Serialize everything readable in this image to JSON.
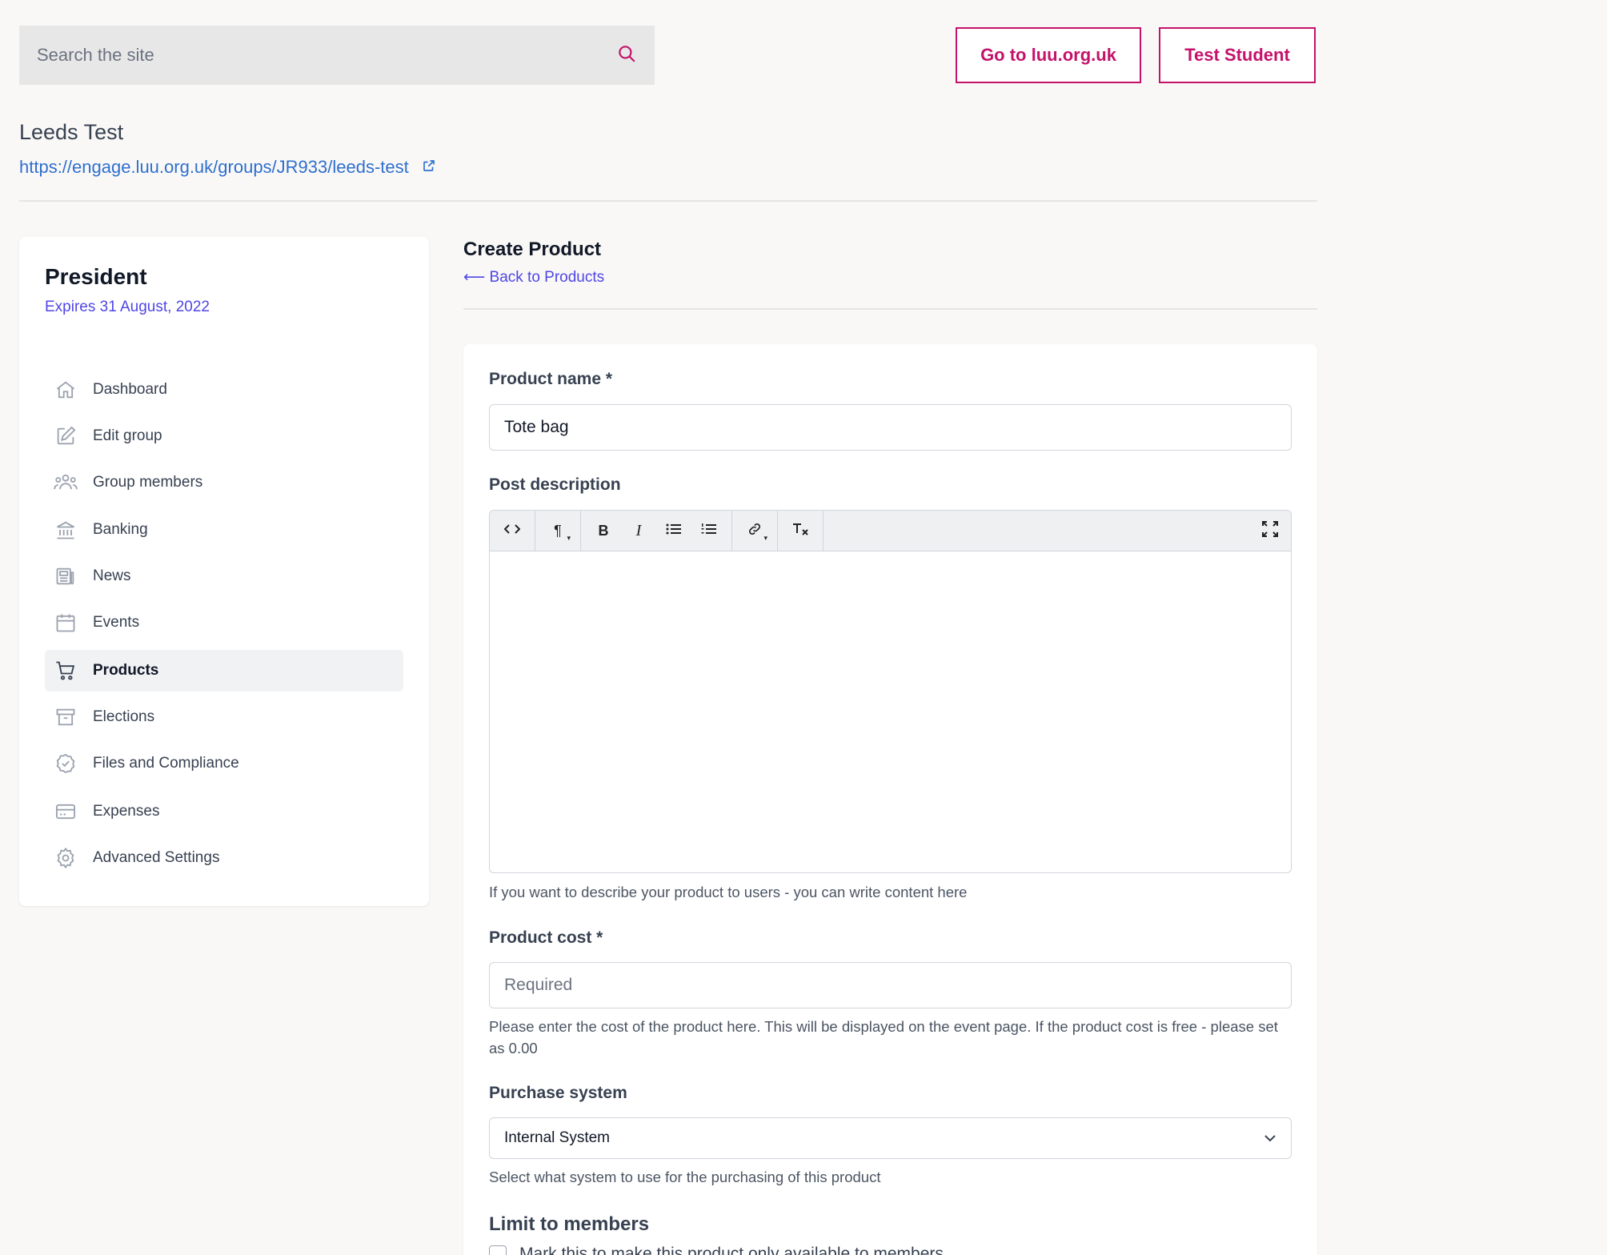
{
  "header": {
    "search_placeholder": "Search the site",
    "go_to_label": "Go to luu.org.uk",
    "user_label": "Test Student"
  },
  "group": {
    "name": "Leeds Test",
    "url": "https://engage.luu.org.uk/groups/JR933/leeds-test"
  },
  "sidebar": {
    "role": "President",
    "expires": "Expires 31 August, 2022",
    "items": [
      {
        "label": "Dashboard",
        "icon": "home-icon"
      },
      {
        "label": "Edit group",
        "icon": "edit-icon"
      },
      {
        "label": "Group members",
        "icon": "users-icon"
      },
      {
        "label": "Banking",
        "icon": "bank-icon"
      },
      {
        "label": "News",
        "icon": "newspaper-icon"
      },
      {
        "label": "Events",
        "icon": "calendar-icon"
      },
      {
        "label": "Products",
        "icon": "cart-icon",
        "active": true
      },
      {
        "label": "Elections",
        "icon": "archive-icon"
      },
      {
        "label": "Files and Compliance",
        "icon": "badge-check-icon"
      },
      {
        "label": "Expenses",
        "icon": "credit-card-icon"
      },
      {
        "label": "Advanced Settings",
        "icon": "gear-icon"
      }
    ]
  },
  "main": {
    "title": "Create Product",
    "back_link": "⟵ Back to Products"
  },
  "form": {
    "product_name_label": "Product name *",
    "product_name_value": "Tote bag",
    "description_label": "Post description",
    "description_help": "If you want to describe your product to users - you can write content here",
    "cost_label": "Product cost *",
    "cost_placeholder": "Required",
    "cost_help": "Please enter the cost of the product here. This will be displayed on the event page. If the product cost is free - please set as 0.00",
    "purchase_label": "Purchase system",
    "purchase_value": "Internal System",
    "purchase_help": "Select what system to use for the purchasing of this product",
    "limit_title": "Limit to members",
    "limit_checkbox_label": "Mark this to make this product only available to members"
  },
  "toolbar": {
    "bold": "B",
    "italic": "I",
    "paragraph": "¶"
  },
  "colors": {
    "accent": "#c4126b",
    "link": "#2f6fcf",
    "indigo": "#4f46e5"
  }
}
